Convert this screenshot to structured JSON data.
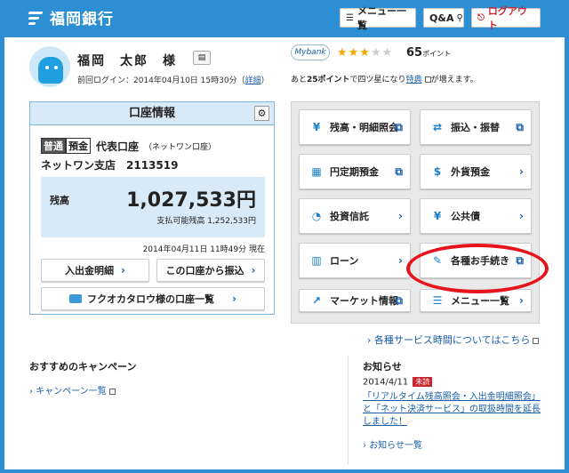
{
  "header": {
    "bank_name": "福岡銀行",
    "menu_label": "メニュー一覧",
    "qa_label": "Q&A",
    "logout_label": "ログアウト"
  },
  "user": {
    "name": "福岡　太郎　様",
    "last_login_prefix": "前回ログイン：2014年04月10日 15時30分（",
    "last_login_link": "詳細",
    "last_login_suffix": "）"
  },
  "mybank": {
    "logo_text": "Mybank",
    "stars_on": "★★★",
    "stars_off": "★★",
    "points": "65",
    "points_unit": "ポイント",
    "note_a": "あと",
    "note_points": "25ポイント",
    "note_b": "で四ツ星になり",
    "note_link": "特典",
    "note_c": "が増えます。"
  },
  "account": {
    "panel_title": "口座情報",
    "type_tag1": "普通",
    "type_tag2": "預金",
    "type_label": "代表口座",
    "type_note": "（ネットワン口座）",
    "branch": "ネットワン支店　2113519",
    "balance_label": "残高",
    "balance_value": "1,027,533円",
    "available": "支払可能残高 1,252,533円",
    "as_of": "2014年04月11日 11時49分 現在",
    "btn_statement": "入出金明細",
    "btn_transfer_from": "この口座から振込",
    "btn_list": "フクオカタロウ様の口座一覧"
  },
  "services": {
    "balance_inquiry": "残高・明細照会",
    "transfer": "振込・振替",
    "time_deposit": "円定期預金",
    "fx_deposit": "外貨預金",
    "investment_trust": "投資信託",
    "public_bonds": "公共債",
    "loan": "ローン",
    "procedures": "各種お手続き",
    "market_info": "マーケット情報",
    "menu_list": "メニュー一覧",
    "service_time": "各種サービス時間についてはこちら"
  },
  "campaign": {
    "heading": "おすすめのキャンペーン",
    "link": "キャンペーン一覧"
  },
  "news": {
    "heading": "お知らせ",
    "date": "2014/4/11",
    "badge": "未読",
    "body": "「リアルタイム残高照会・入出金明細照会」と「ネット決済サービス」の取扱時間を延長しました！",
    "more": "お知らせ一覧"
  }
}
